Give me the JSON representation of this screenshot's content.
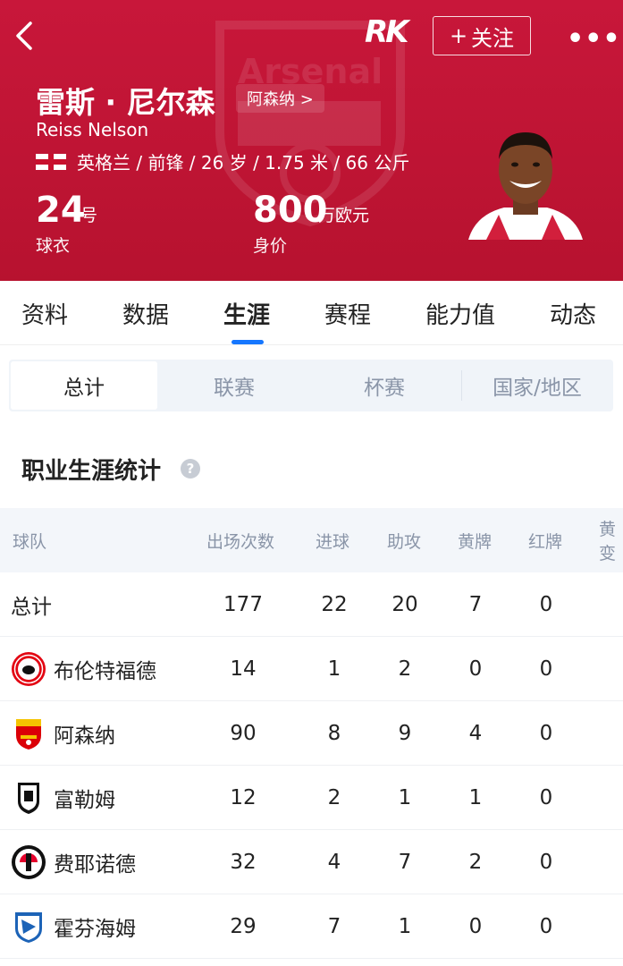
{
  "header": {
    "logo_text": "RK",
    "follow_label": "关注",
    "follow_plus": "+",
    "more_label": "•••",
    "back_label": "<"
  },
  "player": {
    "name_cn": "雷斯 · 尼尔森",
    "name_en": "Reiss Nelson",
    "team_link": "阿森纳 >",
    "meta": "英格兰 / 前锋 / 26 岁 / 1.75 米 / 66 公斤",
    "shirt_number": "24",
    "shirt_unit": "号",
    "shirt_label": "球衣",
    "value": "800",
    "value_unit": "万欧元",
    "value_label": "身价",
    "background_crest_text": "Arsenal"
  },
  "tabs": [
    "资料",
    "数据",
    "生涯",
    "赛程",
    "能力值",
    "动态"
  ],
  "active_tab": "生涯",
  "segments": [
    "总计",
    "联赛",
    "杯赛",
    "国家/地区"
  ],
  "active_segment": "总计",
  "section_title": "职业生涯统计",
  "table": {
    "columns": [
      "球队",
      "出场次数",
      "进球",
      "助攻",
      "黄牌",
      "红牌",
      "黄变"
    ],
    "rows": [
      {
        "team": "总计",
        "icon": "",
        "apps": "177",
        "goals": "22",
        "assists": "20",
        "yellow": "7",
        "red": "0"
      },
      {
        "team": "布伦特福德",
        "icon": "brentford-badge-icon",
        "apps": "14",
        "goals": "1",
        "assists": "2",
        "yellow": "0",
        "red": "0"
      },
      {
        "team": "阿森纳",
        "icon": "arsenal-badge-icon",
        "apps": "90",
        "goals": "8",
        "assists": "9",
        "yellow": "4",
        "red": "0"
      },
      {
        "team": "富勒姆",
        "icon": "fulham-badge-icon",
        "apps": "12",
        "goals": "2",
        "assists": "1",
        "yellow": "1",
        "red": "0"
      },
      {
        "team": "费耶诺德",
        "icon": "feyenoord-badge-icon",
        "apps": "32",
        "goals": "4",
        "assists": "7",
        "yellow": "2",
        "red": "0"
      },
      {
        "team": "霍芬海姆",
        "icon": "hoffenheim-badge-icon",
        "apps": "29",
        "goals": "7",
        "assists": "1",
        "yellow": "0",
        "red": "0"
      }
    ]
  },
  "colors": {
    "header_red": "#c8173a",
    "accent_blue": "#1677ff",
    "muted_text": "#8a95a8"
  }
}
